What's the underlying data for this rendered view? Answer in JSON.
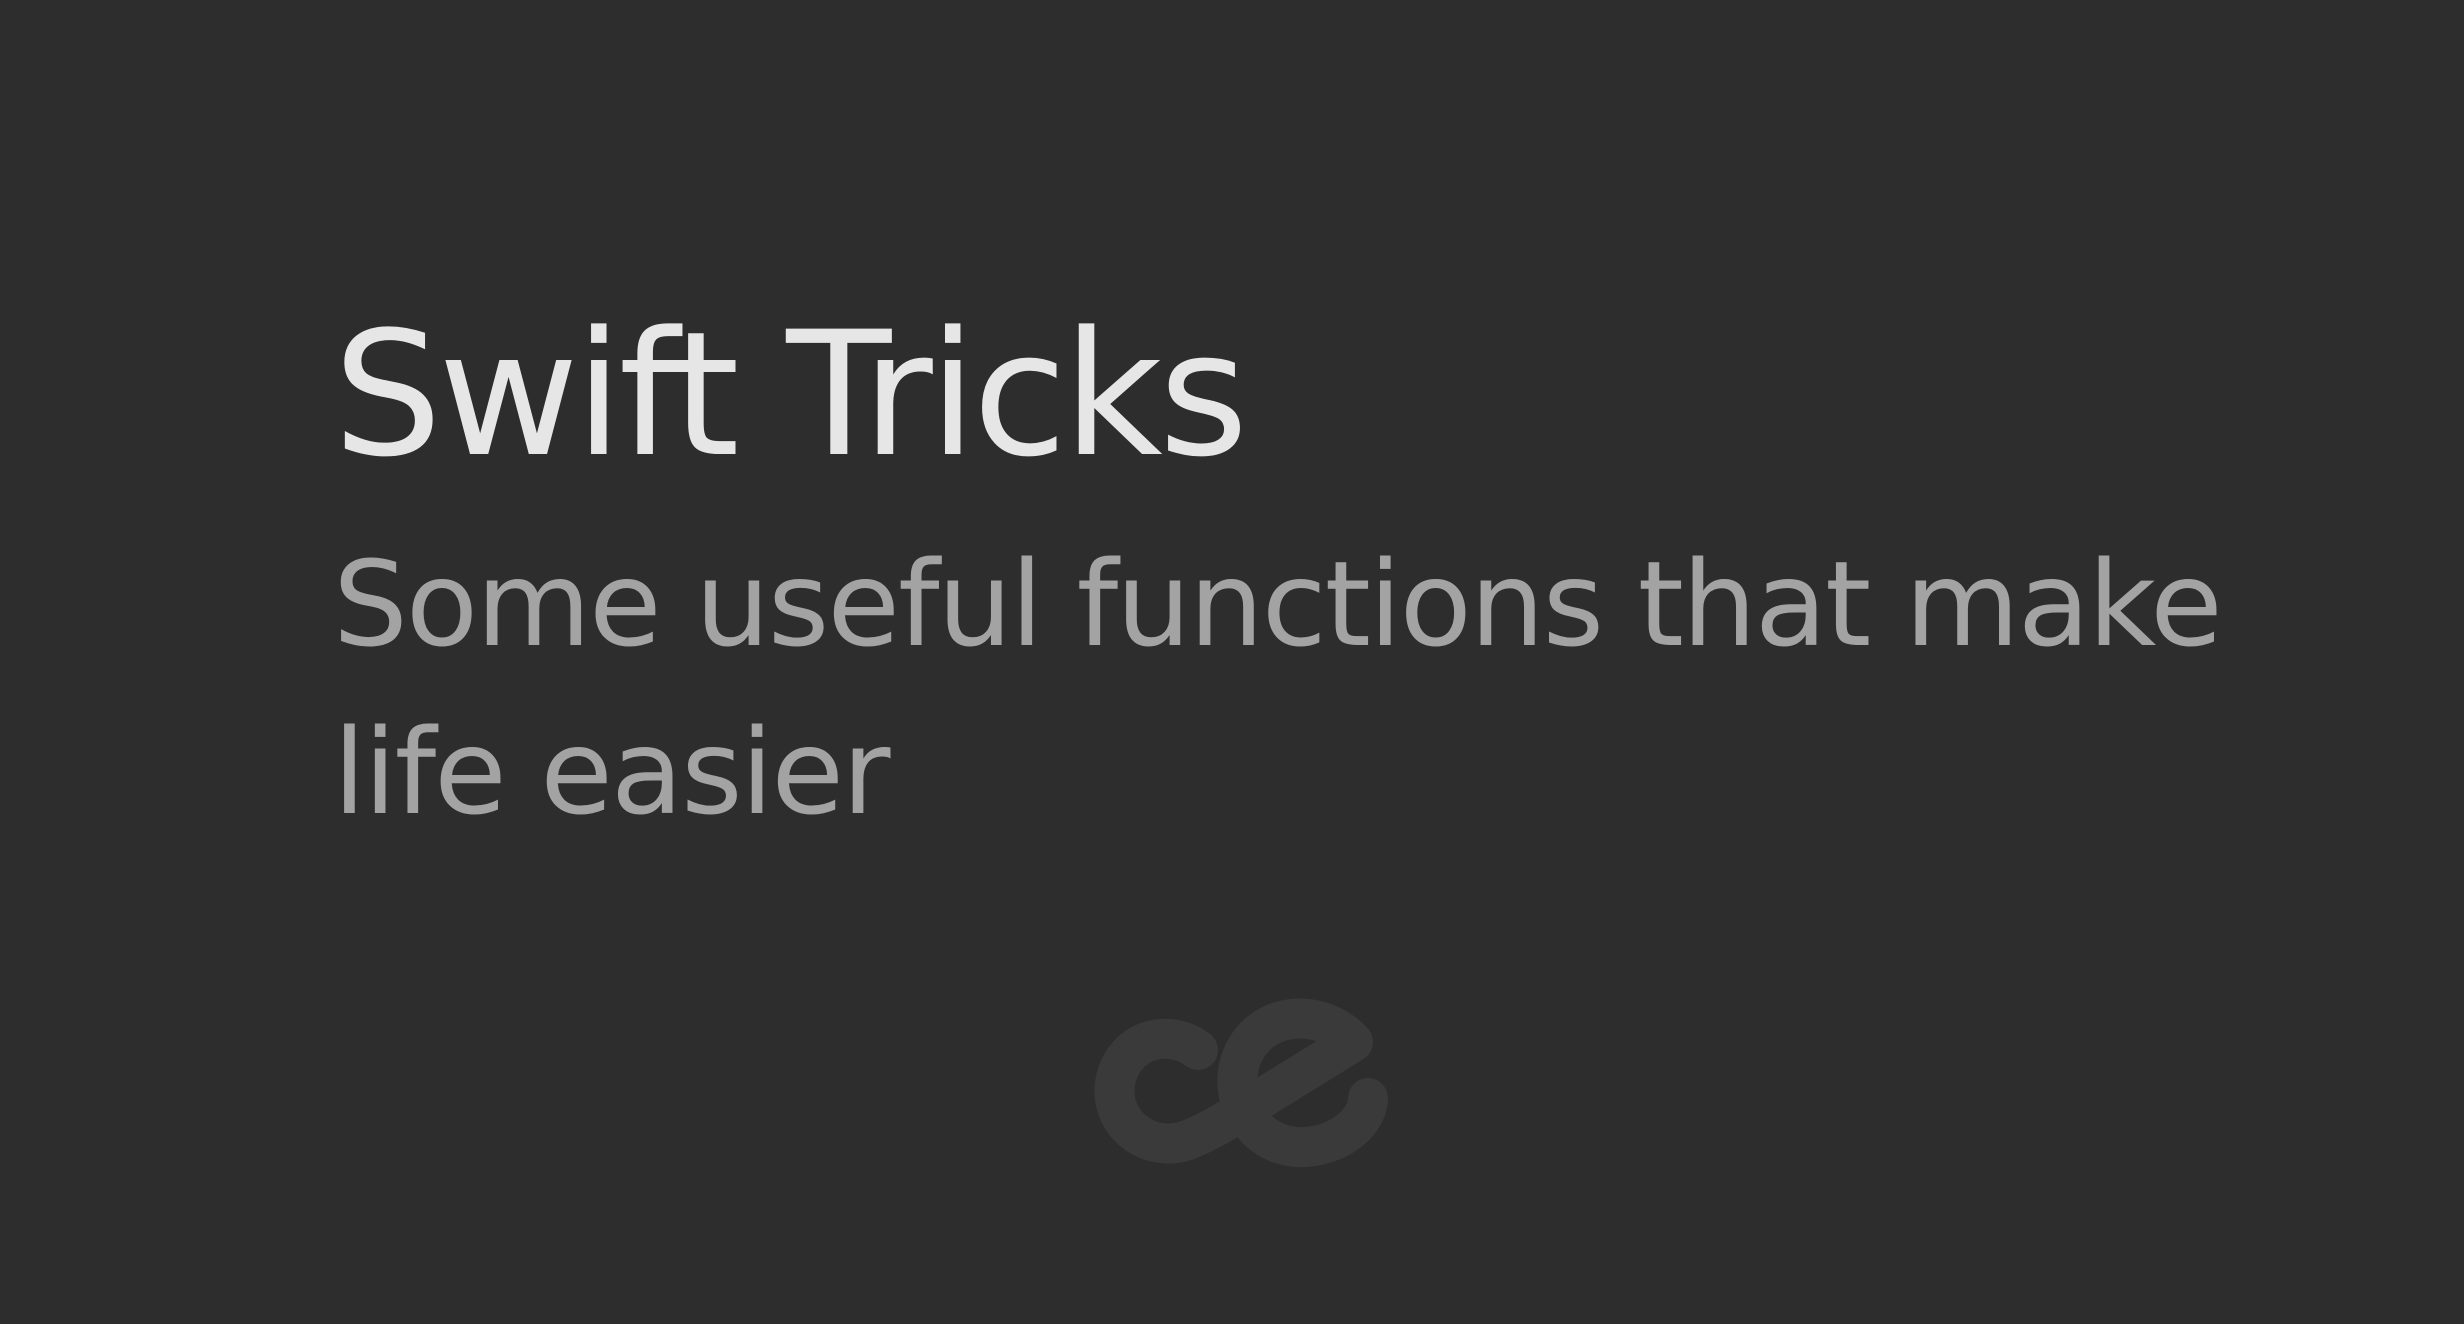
{
  "page": {
    "title": "Swift Tricks",
    "subtitle": "Some useful functions that make life easier"
  },
  "logo": {
    "text": "ce",
    "color": "#3a3a3a"
  },
  "colors": {
    "background": "#2d2d2d",
    "title": "#e6e6e6",
    "subtitle": "#a3a3a3"
  }
}
